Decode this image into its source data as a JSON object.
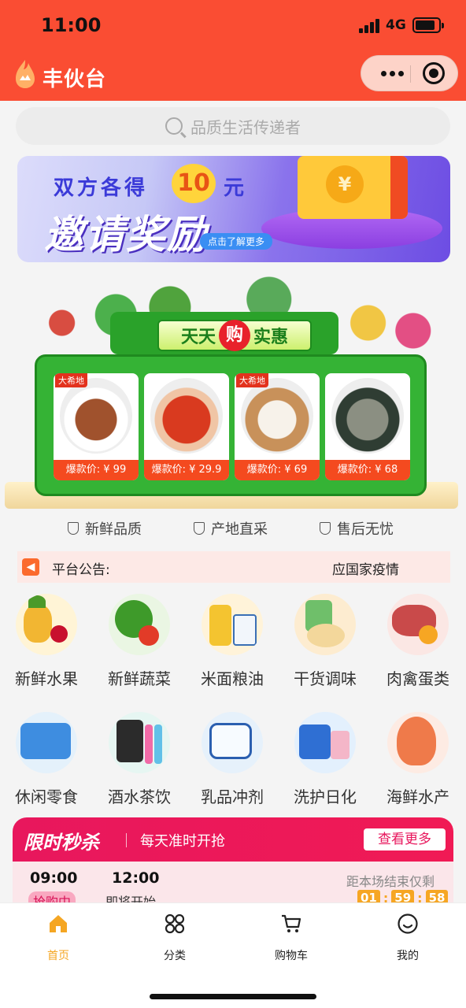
{
  "status_bar": {
    "time": "11:00",
    "network": "4G"
  },
  "header": {
    "app_title": "丰伙台"
  },
  "search": {
    "placeholder": "品质生活传递者"
  },
  "banner": {
    "line1": "双方各得",
    "amount": "10",
    "unit": "元",
    "line2": "邀请奖励",
    "button": "点击了解更多",
    "coin_symbol": "¥"
  },
  "deals": {
    "title_left": "天天",
    "title_mid": "购",
    "title_right": "实惠",
    "products": [
      {
        "brand": "大希地",
        "price": "爆款价: ¥ 99"
      },
      {
        "brand": "",
        "price": "爆款价: ¥ 29.9"
      },
      {
        "brand": "大希地",
        "price": "爆款价: ¥ 69"
      },
      {
        "brand": "",
        "price": "爆款价: ¥ 68"
      }
    ]
  },
  "features": [
    "新鲜品质",
    "产地直采",
    "售后无忧"
  ],
  "notice": {
    "label": "平台公告:",
    "text": "应国家疫情"
  },
  "categories": [
    {
      "name": "新鲜水果",
      "icon": "fruit-icon"
    },
    {
      "name": "新鲜蔬菜",
      "icon": "vegetable-icon"
    },
    {
      "name": "米面粮油",
      "icon": "grain-oil-icon"
    },
    {
      "name": "干货调味",
      "icon": "seasoning-icon"
    },
    {
      "name": "肉禽蛋类",
      "icon": "meat-egg-icon"
    },
    {
      "name": "休闲零食",
      "icon": "snack-icon"
    },
    {
      "name": "酒水茶饮",
      "icon": "drink-icon"
    },
    {
      "name": "乳品冲剂",
      "icon": "dairy-icon"
    },
    {
      "name": "洗护日化",
      "icon": "toiletry-icon"
    },
    {
      "name": "海鲜水产",
      "icon": "seafood-icon"
    }
  ],
  "flash_sale": {
    "title": "限时秒杀",
    "subtitle": "每天准时开抢",
    "more": "查看更多",
    "slots": [
      {
        "time": "09:00",
        "status": "抢购中"
      },
      {
        "time": "12:00",
        "status": "即将开始"
      }
    ],
    "remain_label": "距本场结束仅剩",
    "countdown": [
      "01",
      "59",
      "58"
    ]
  },
  "tabbar": [
    {
      "label": "首页",
      "icon": "home-icon",
      "active": true
    },
    {
      "label": "分类",
      "icon": "category-icon",
      "active": false
    },
    {
      "label": "购物车",
      "icon": "cart-icon",
      "active": false
    },
    {
      "label": "我的",
      "icon": "profile-icon",
      "active": false
    }
  ],
  "colors": {
    "header": "#fa4d33",
    "accent": "#f5a623",
    "flash": "#e8175d"
  }
}
